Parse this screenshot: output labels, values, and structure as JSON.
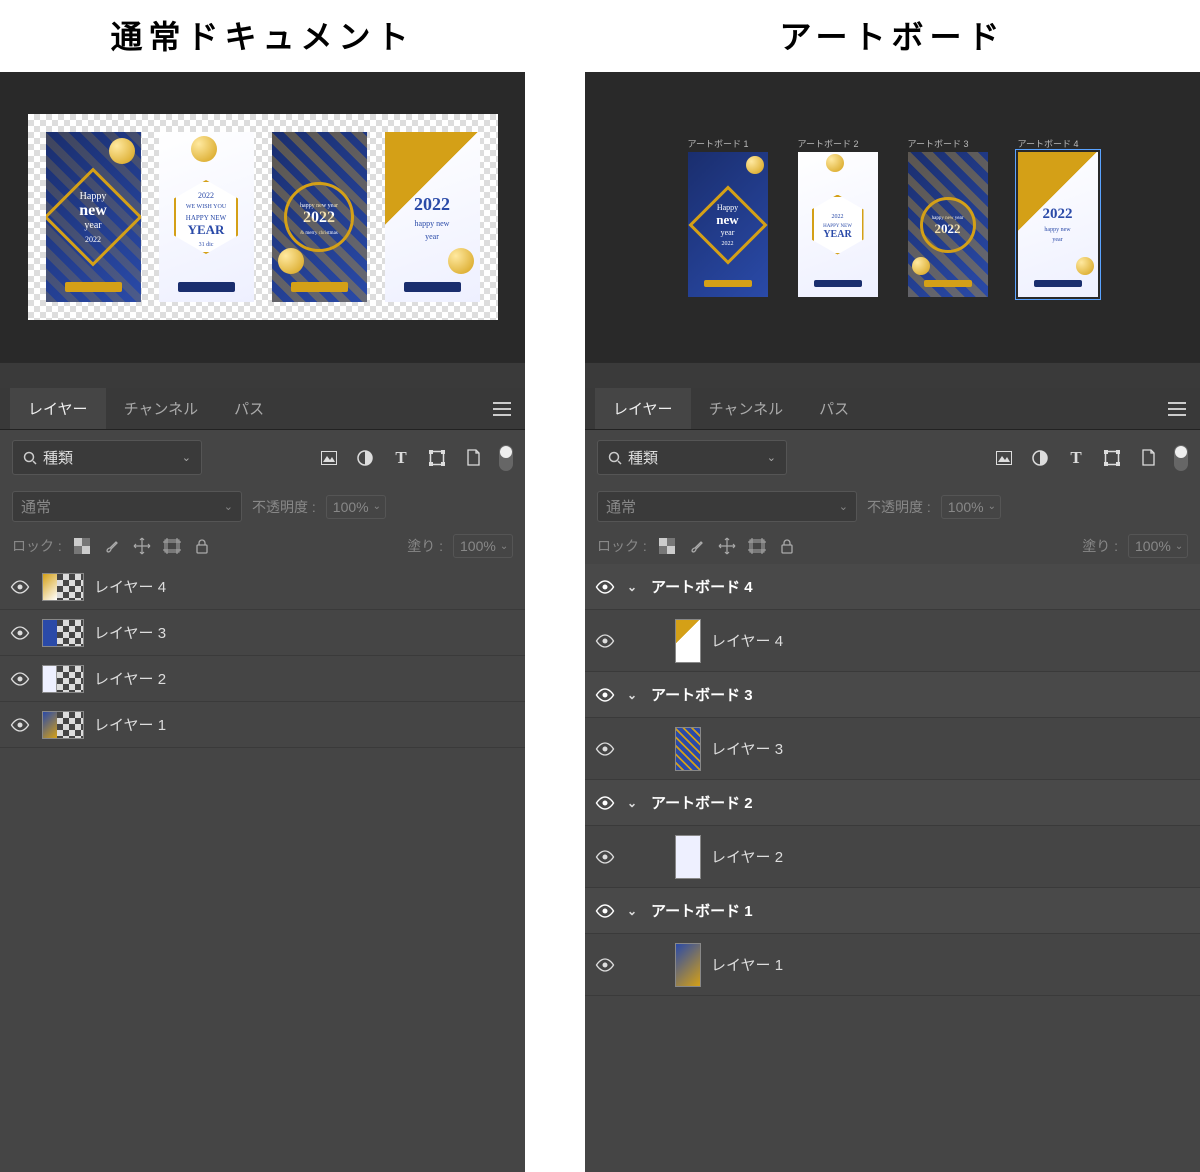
{
  "titles": {
    "left": "通常ドキュメント",
    "right": "アートボード"
  },
  "artboard_labels": [
    "アートボード 1",
    "アートボード 2",
    "アートボード 3",
    "アートボード 4"
  ],
  "cards": [
    {
      "style": "blue",
      "shape": "diamond",
      "line1": "Happy",
      "line2": "new",
      "line3": "year",
      "sub": "2022"
    },
    {
      "style": "white",
      "shape": "hex",
      "line1": "2022",
      "line2": "WE WISH YOU",
      "line3": "HAPPY NEW",
      "line4": "YEAR",
      "sub": "31 dic"
    },
    {
      "style": "blue",
      "shape": "ring",
      "line1": "happy new year",
      "line2": "2022",
      "line3": "& merry christmas"
    },
    {
      "style": "white",
      "shape": "tri",
      "line1": "2022",
      "line2": "happy new",
      "line3": "year"
    }
  ],
  "panel": {
    "tabs": [
      "レイヤー",
      "チャンネル",
      "パス"
    ],
    "active_tab": 0,
    "filter": {
      "search_label": "種類"
    },
    "blend": {
      "mode": "通常",
      "opacity_label": "不透明度 :",
      "opacity_value": "100%"
    },
    "lock": {
      "label": "ロック :",
      "fill_label": "塗り :",
      "fill_value": "100%"
    },
    "left_layers": [
      {
        "name": "レイヤー 4",
        "thumb": "c4"
      },
      {
        "name": "レイヤー 3",
        "thumb": "c3"
      },
      {
        "name": "レイヤー 2",
        "thumb": "c2"
      },
      {
        "name": "レイヤー 1",
        "thumb": "c1"
      }
    ],
    "right_layers": [
      {
        "type": "group",
        "name": "アートボード 4"
      },
      {
        "type": "layer",
        "name": "レイヤー 4",
        "thumb": "c4"
      },
      {
        "type": "group",
        "name": "アートボード 3"
      },
      {
        "type": "layer",
        "name": "レイヤー 3",
        "thumb": "c3"
      },
      {
        "type": "group",
        "name": "アートボード 2"
      },
      {
        "type": "layer",
        "name": "レイヤー 2",
        "thumb": "c2"
      },
      {
        "type": "group",
        "name": "アートボード 1"
      },
      {
        "type": "layer",
        "name": "レイヤー 1",
        "thumb": "c1"
      }
    ]
  }
}
